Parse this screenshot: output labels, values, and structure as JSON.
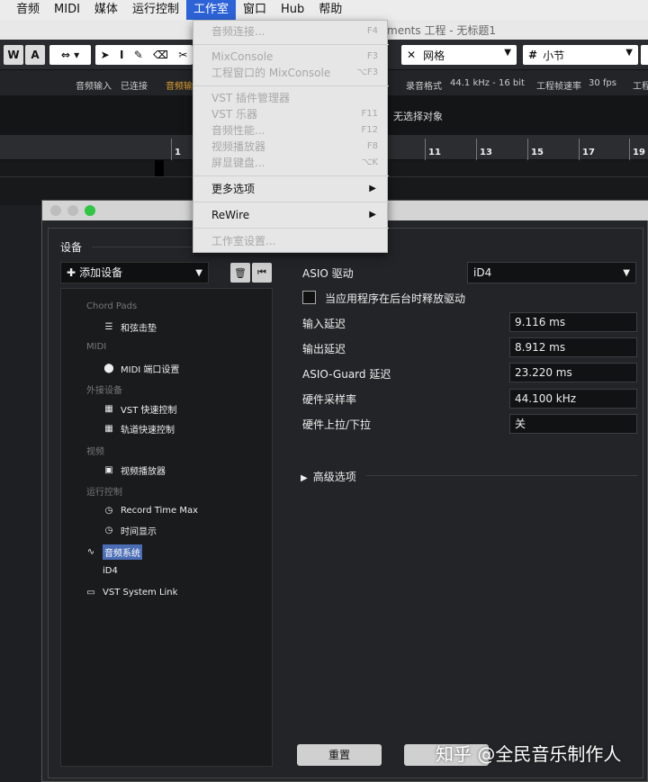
{
  "menubar": {
    "items": [
      "音频",
      "MIDI",
      "媒体",
      "运行控制",
      "工作室",
      "窗口",
      "Hub",
      "帮助"
    ],
    "active_index": 4
  },
  "window_title": "ments 工程 - 无标题1",
  "toolbar": {
    "btn_w": "W",
    "btn_a": "A",
    "grid_label": "网格",
    "bar_label": "小节"
  },
  "infoline": {
    "audio_input": "音频输入",
    "connected": "已连接",
    "audio_out": "音频输",
    "record_format_label": "录音格式",
    "record_format_value": "44.1 kHz - 16 bit",
    "frame_rate_label": "工程帧速率",
    "frame_rate_value": "30 fps",
    "more": "工程"
  },
  "strip": {
    "no_selection": "无选择对象"
  },
  "ruler": {
    "bars": [
      "1",
      "11",
      "13",
      "15",
      "17",
      "19"
    ]
  },
  "studio_menu": {
    "items": [
      {
        "label": "音频连接...",
        "shortcut": "F4",
        "disabled": true
      },
      {
        "label": "MixConsole",
        "shortcut": "F3",
        "disabled": true
      },
      {
        "label": "工程窗口的 MixConsole",
        "shortcut": "⌥F3",
        "disabled": true
      },
      {
        "label": "VST 插件管理器",
        "shortcut": "",
        "disabled": true
      },
      {
        "label": "VST 乐器",
        "shortcut": "F11",
        "disabled": true
      },
      {
        "label": "音频性能...",
        "shortcut": "F12",
        "disabled": true
      },
      {
        "label": "视频播放器",
        "shortcut": "F8",
        "disabled": true
      },
      {
        "label": "屏显键盘...",
        "shortcut": "⌥K",
        "disabled": true
      },
      {
        "label": "更多选项",
        "shortcut": "",
        "disabled": false,
        "submenu": true
      },
      {
        "label": "ReWire",
        "shortcut": "",
        "disabled": false,
        "submenu": true
      },
      {
        "label": "工作室设置...",
        "shortcut": "",
        "disabled": true
      }
    ]
  },
  "dialog": {
    "devices_label": "设备",
    "add_device": "添加设备",
    "tree": {
      "groups": [
        "Chord Pads",
        "MIDI",
        "外接设备",
        "视频",
        "运行控制"
      ],
      "items": [
        "和弦击垫",
        "MIDI 端口设置",
        "VST 快速控制",
        "轨道快速控制",
        "视频播放器",
        "Record Time Max",
        "时间显示"
      ],
      "audio_system": "音频系统",
      "id4": "iD4",
      "vst_system_link": "VST System Link"
    },
    "asio_driver_label": "ASIO 驱动",
    "asio_driver_value": "iD4",
    "release_driver_label": "当应用程序在后台时释放驱动",
    "input_latency_label": "输入延迟",
    "input_latency_value": "9.116 ms",
    "output_latency_label": "输出延迟",
    "output_latency_value": "8.912 ms",
    "asio_guard_label": "ASIO-Guard 延迟",
    "asio_guard_value": "23.220 ms",
    "hw_samplerate_label": "硬件采样率",
    "hw_samplerate_value": "44.100 kHz",
    "hw_pull_label": "硬件上拉/下拉",
    "hw_pull_value": "关",
    "advanced_label": "高级选项",
    "reset_button": "重置"
  },
  "watermark": "知乎 @全民音乐制作人"
}
